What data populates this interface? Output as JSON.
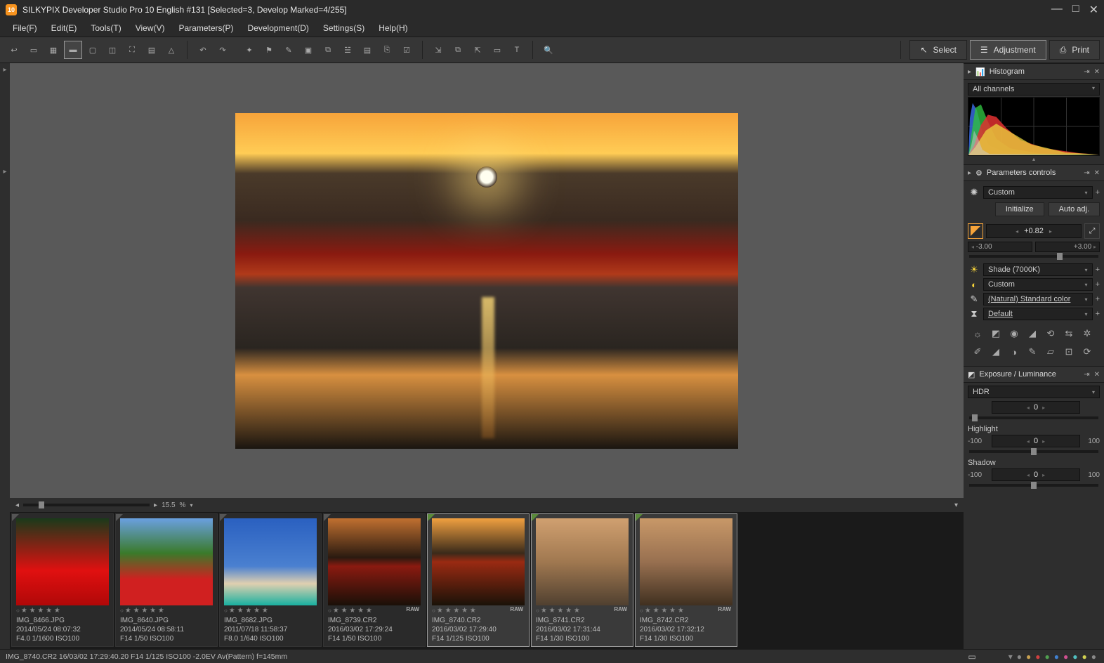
{
  "titlebar": {
    "app_badge": "10",
    "title": "SILKYPIX Developer Studio Pro 10 English   #131   [Selected=3, Develop Marked=4/255]"
  },
  "menu": {
    "file": "File(F)",
    "edit": "Edit(E)",
    "tools": "Tools(T)",
    "view": "View(V)",
    "parameters": "Parameters(P)",
    "development": "Development(D)",
    "settings": "Settings(S)",
    "help": "Help(H)"
  },
  "modes": {
    "select": "Select",
    "adjustment": "Adjustment",
    "print": "Print"
  },
  "zoom": {
    "value": "15.5",
    "unit": "%"
  },
  "panels": {
    "histogram": {
      "title": "Histogram",
      "mode": "All channels"
    },
    "params": {
      "title": "Parameters controls",
      "preset": "Custom",
      "initialize": "Initialize",
      "autoadj": "Auto adj.",
      "ev_value": "+0.82",
      "ev_min": "-3.00",
      "ev_max": "+3.00",
      "wb": "Shade (7000K)",
      "tone": "Custom",
      "color": "(Natural) Standard color",
      "nr": "Default"
    },
    "exposure": {
      "title": "Exposure / Luminance",
      "mode": "HDR",
      "hdr_value": "0",
      "highlight_label": "Highlight",
      "highlight_value": "0",
      "highlight_min": "-100",
      "highlight_max": "100",
      "shadow_label": "Shadow",
      "shadow_value": "0",
      "shadow_min": "-100",
      "shadow_max": "100"
    }
  },
  "thumbs": [
    {
      "name": "IMG_8466.JPG",
      "date": "2014/05/24 08:07:32",
      "exif": "F4.0 1/1600 ISO100",
      "raw": "",
      "selected": false,
      "edited": false,
      "bg": "linear-gradient(180deg,#1a3a1a 0%,#e01010 60%,#b00808 100%)"
    },
    {
      "name": "IMG_8640.JPG",
      "date": "2014/05/24 08:58:11",
      "exif": "F14 1/50 ISO100",
      "raw": "",
      "selected": false,
      "edited": false,
      "bg": "linear-gradient(180deg,#6aa0e0 0%,#3a7a2a 40%,#d02020 70%)"
    },
    {
      "name": "IMG_8682.JPG",
      "date": "2011/07/18 11:58:37",
      "exif": "F8.0 1/640 ISO100",
      "raw": "",
      "selected": false,
      "edited": false,
      "bg": "linear-gradient(180deg,#2a60c0 0%,#4a80d0 55%,#e0d0b0 75%,#18b0a0 100%)"
    },
    {
      "name": "IMG_8739.CR2",
      "date": "2016/03/02 17:29:24",
      "exif": "F14 1/50 ISO100",
      "raw": "RAW",
      "selected": false,
      "edited": false,
      "bg": "linear-gradient(180deg,#c07030 0%,#2a1a10 45%,#8a1a10 55%,#1a1008 100%)"
    },
    {
      "name": "IMG_8740.CR2",
      "date": "2016/03/02 17:29:40",
      "exif": "F14 1/125 ISO100",
      "raw": "RAW",
      "selected": true,
      "edited": true,
      "bg": "linear-gradient(180deg,#f0a040 0%,#3a2a1a 40%,#9a2a12 50%,#1a1208 100%)"
    },
    {
      "name": "IMG_8741.CR2",
      "date": "2016/03/02 17:31:44",
      "exif": "F14 1/30 ISO100",
      "raw": "RAW",
      "selected": true,
      "edited": true,
      "bg": "linear-gradient(180deg,#d0a070 0%,#a07850 50%,#504030 100%)"
    },
    {
      "name": "IMG_8742.CR2",
      "date": "2016/03/02 17:32:12",
      "exif": "F14 1/30 ISO100",
      "raw": "RAW",
      "selected": true,
      "edited": true,
      "bg": "linear-gradient(180deg,#c89868 0%,#987050 50%,#403020 100%)"
    }
  ],
  "statusbar": {
    "text": "IMG_8740.CR2 16/03/02 17:29:40.20 F14 1/125 ISO100 -2.0EV Av(Pattern) f=145mm"
  },
  "status_icons_colors": [
    "#888",
    "#c8a050",
    "#d04040",
    "#50a050",
    "#4080d0",
    "#d05090",
    "#50c0c0",
    "#d0d050",
    "#888"
  ]
}
